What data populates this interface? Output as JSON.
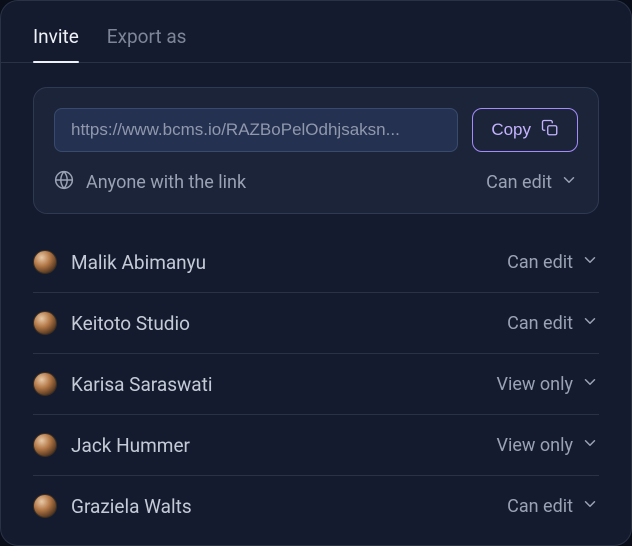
{
  "tabs": {
    "invite": "Invite",
    "export": "Export as"
  },
  "link": {
    "url": "https://www.bcms.io/RAZBoPelOdhjsaksn...",
    "copy_label": "Copy",
    "access_label": "Anyone with the link",
    "permission": "Can edit"
  },
  "people": [
    {
      "name": "Malik Abimanyu",
      "permission": "Can edit"
    },
    {
      "name": "Keitoto Studio",
      "permission": "Can edit"
    },
    {
      "name": "Karisa Saraswati",
      "permission": "View only"
    },
    {
      "name": "Jack Hummer",
      "permission": "View only"
    },
    {
      "name": "Graziela Walts",
      "permission": "Can edit"
    }
  ]
}
